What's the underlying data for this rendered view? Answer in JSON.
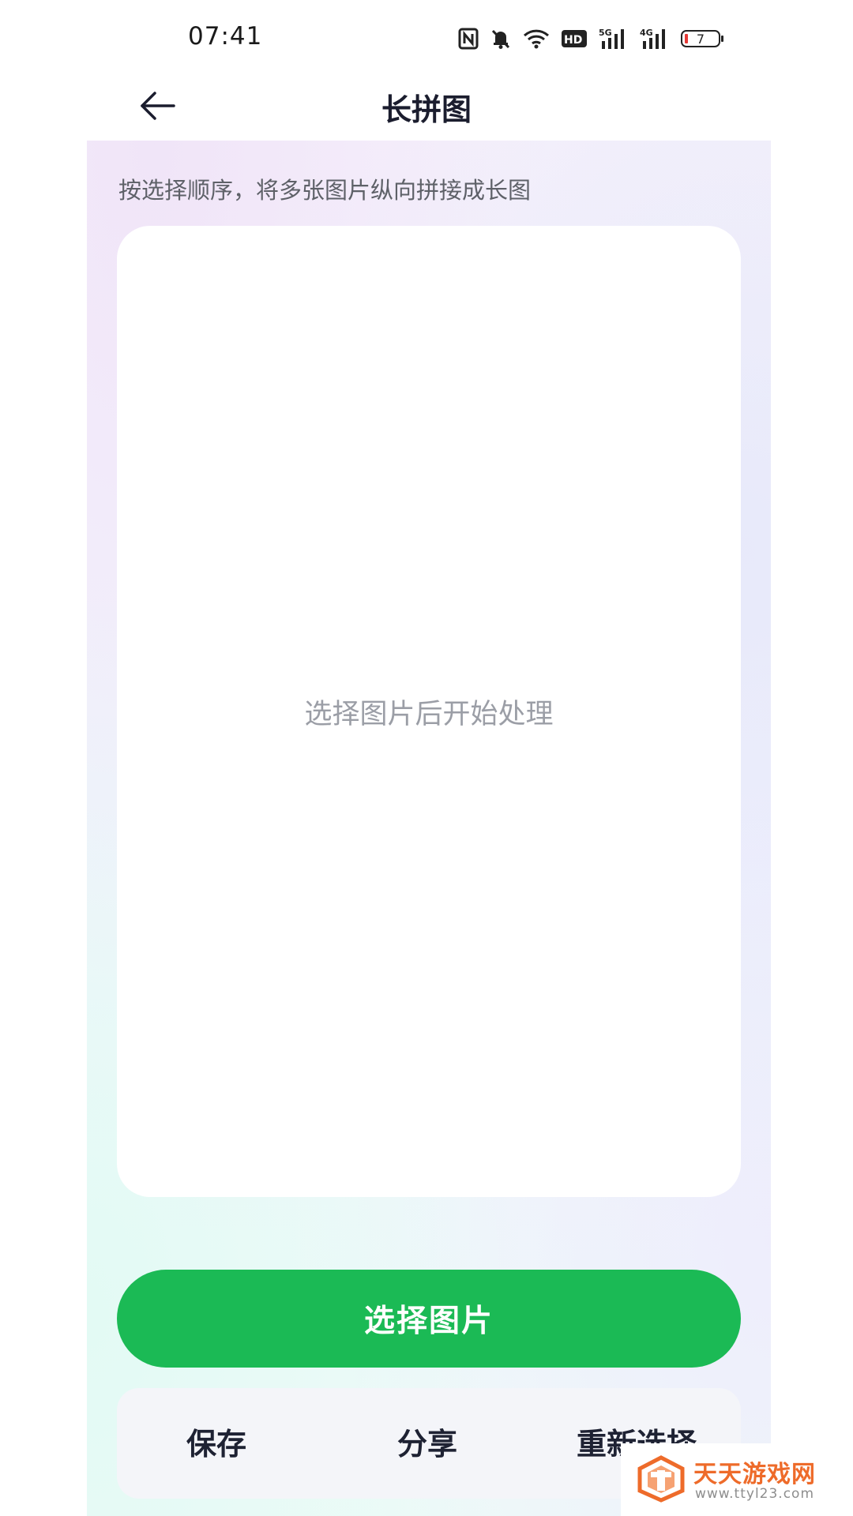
{
  "status_bar": {
    "time": "07:41",
    "battery_level": "7",
    "signal_5g_label": "5G",
    "signal_4g_label": "4G",
    "hd_label": "HD"
  },
  "header": {
    "title": "长拼图"
  },
  "main": {
    "hint": "按选择顺序，将多张图片纵向拼接成长图",
    "preview_placeholder": "选择图片后开始处理",
    "select_button_label": "选择图片"
  },
  "actions": {
    "save_label": "保存",
    "share_label": "分享",
    "reselect_label": "重新选择"
  },
  "watermark": {
    "name": "天天游戏网",
    "url": "www.ttyl23.com"
  },
  "colors": {
    "primary_green": "#1bba55",
    "title_text": "#1b1d2e",
    "watermark_orange": "#ee6b2a"
  },
  "icons": {
    "back": "arrow-left-icon",
    "nfc": "nfc-icon",
    "mute": "bell-off-icon",
    "wifi": "wifi-icon",
    "battery": "battery-icon"
  }
}
